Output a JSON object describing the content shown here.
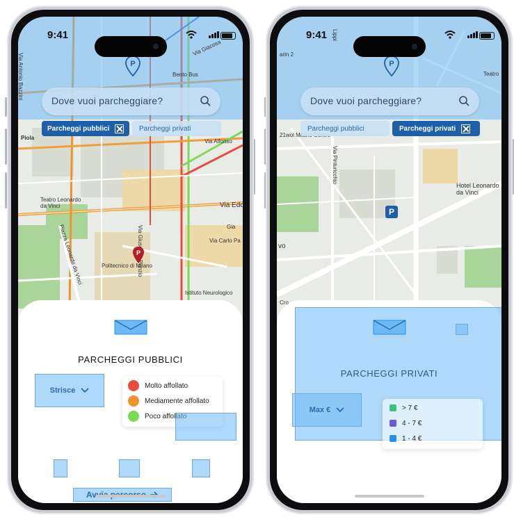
{
  "status": {
    "time": "9:41"
  },
  "search": {
    "placeholder": "Dove vuoi parcheggiare?"
  },
  "filters": {
    "public_label": "Parcheggi pubblici",
    "private_label": "Parcheggi privati"
  },
  "left": {
    "sheet_title": "PARCHEGGI PUBBLICI",
    "dropdown_label": "Strisce",
    "legend": [
      {
        "label": "Molto affollato",
        "color": "#e74c3c"
      },
      {
        "label": "Mediamente affollato",
        "color": "#f0922e"
      },
      {
        "label": "Poco affollato",
        "color": "#7ed957"
      }
    ],
    "cta_label": "Avvia percorso",
    "map_labels": {
      "piola": "Piola",
      "teatro": "Teatro Leonardo\nda Vinci",
      "politecnico": "Politecnico di Milano",
      "istituto": "Istituto Neurologico",
      "via_edo": "Via Edo",
      "via_ponzio": "Via Giuseppe Ponzio",
      "via_leonardo": "Piazza Leonardo da Vinci",
      "bento": "Bento Bus",
      "alfonso": "Via Alfonso",
      "carlo_pa": "Via Carlo Pa",
      "bazzini": "Via Antonio Bazzini",
      "giacosa": "Via Giacosa",
      "gia": "Gia"
    }
  },
  "right": {
    "sheet_title": "PARCHEGGI PRIVATI",
    "dropdown_label": "Max €",
    "legend": [
      {
        "label": "> 7 €",
        "color": "#3fbf7f"
      },
      {
        "label": "4 - 7 €",
        "color": "#6b5bd6"
      },
      {
        "label": "1 - 4 €",
        "color": "#2c8fe0"
      }
    ],
    "map_labels": {
      "hotel": "Hotel Leonardo\nda Vinci",
      "pinturicchio": "Via Pinturicchio",
      "wol": "21wol Milano Centro",
      "teatro": "Teatro",
      "lippi": "Lippi",
      "arin": "arin 2",
      "vo": "vo",
      "cro": "Cro"
    }
  },
  "colors": {
    "accent": "#2c6aa8",
    "overlay": "#6eb9f5",
    "parking": "#1e5fa8",
    "pin_red": "#b0202a"
  }
}
